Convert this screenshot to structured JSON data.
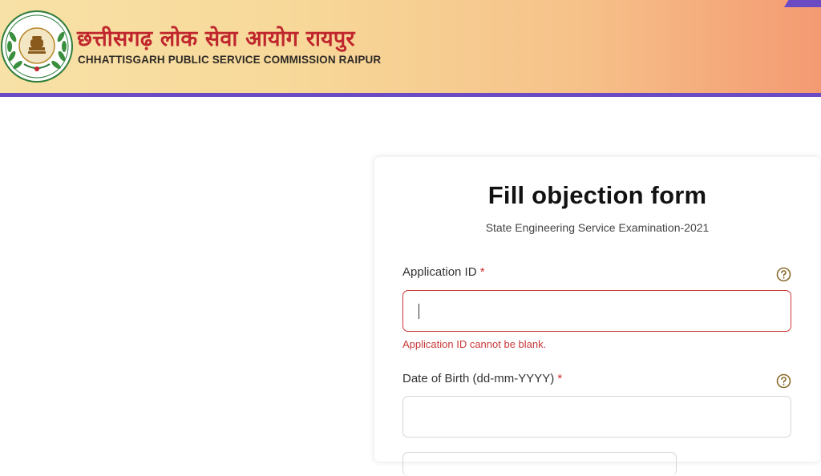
{
  "header": {
    "title_hindi": "छत्तीसगढ़ लोक सेवा आयोग रायपुर",
    "title_english": "CHHATTISGARH PUBLIC SERVICE COMMISSION RAIPUR",
    "logo_icon": "state-emblem-icon",
    "accent_color": "#6a4bc4",
    "title_color": "#c0262d"
  },
  "form": {
    "title": "Fill objection form",
    "subtitle": "State Engineering Service Examination-2021",
    "fields": [
      {
        "label": "Application ID",
        "required_mark": "*",
        "value": "",
        "error": "Application ID cannot be blank.",
        "help_icon": "question-circle-icon"
      },
      {
        "label": "Date of Birth (dd-mm-YYYY)",
        "required_mark": "*",
        "value": "",
        "help_icon": "question-circle-icon"
      }
    ],
    "error_color": "#c93838"
  }
}
